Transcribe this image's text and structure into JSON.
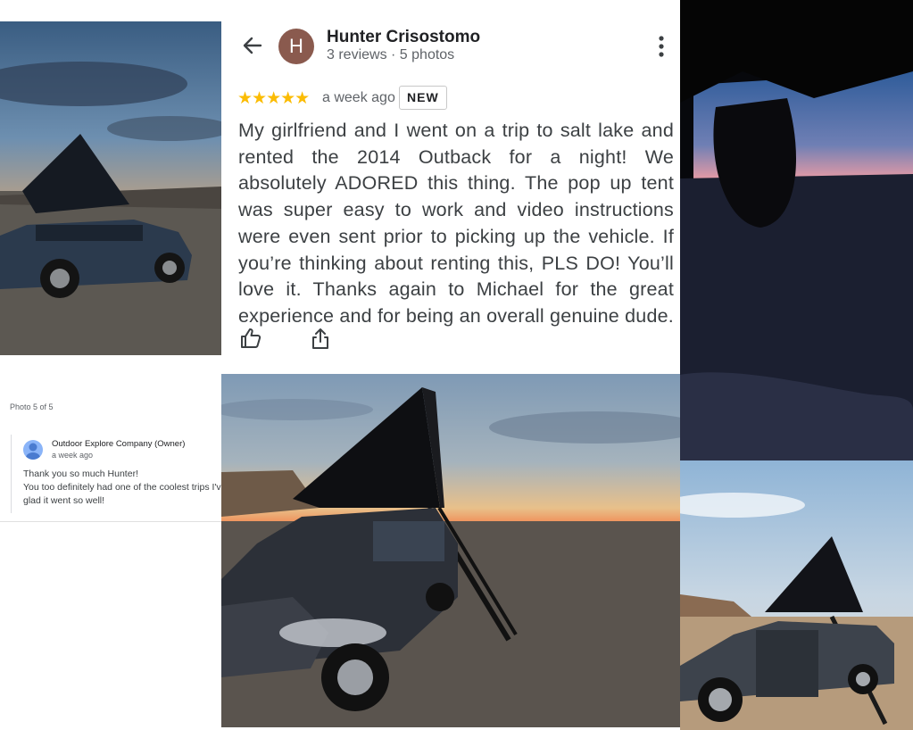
{
  "review": {
    "avatar_initial": "H",
    "reviewer_name": "Hunter Crisostomo",
    "reviewer_meta": "3 reviews · 5 photos",
    "rating": 5,
    "stars": "★★★★★",
    "time": "a week ago",
    "badge": "NEW",
    "text": "My girlfriend and I went on a trip to salt lake and rented the 2014 Outback for a night! We absolutely ADORED this thing. The pop up tent was super easy to work and video instructions were even sent prior to picking up the vehicle. If you’re thinking about renting this, PLS DO! You’ll love it. Thanks again to Michael for the great experience and for being an overall genuine dude."
  },
  "owner_response": {
    "photo_counter": "Photo 5 of 5",
    "owner_name": "Outdoor Explore Company (Owner)",
    "time": "a week ago",
    "reply": "Thank you so much Hunter!\nYou too definitely had one of the coolest trips I've\nglad it went so well!"
  },
  "icons": {
    "back": "arrow-left-icon",
    "more": "more-vertical-icon",
    "like": "thumbs-up-icon",
    "share": "share-icon"
  },
  "colors": {
    "star": "#fbbc04",
    "avatar_bg": "#8a5a4e",
    "text": "#3c4043"
  }
}
